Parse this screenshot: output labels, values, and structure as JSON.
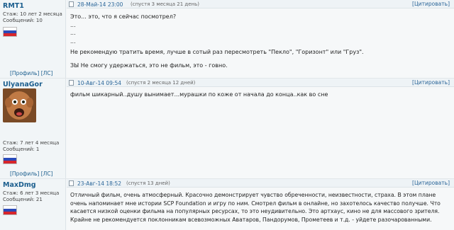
{
  "posts": [
    {
      "user": "RMT1",
      "stats": [
        "Стаж: 10 лет 2 месяца",
        "Сообщений: 10"
      ],
      "links": "[Профиль] [ЛС]",
      "date": "28-Май-14 23:00",
      "ago": "(спустя 3 месяца 21 день)",
      "quote": "[Цитировать]",
      "lines": [
        "Это... это, что я сейчас посмотрел?",
        "...",
        "...",
        "...",
        "Не рекомендую тратить время, лучше в сотый раз пересмотреть \"Пекло\", \"Горизонт\" или \"Груз\".",
        "ЗЫ Не смогу удержаться, это не фильм, это - говно."
      ]
    },
    {
      "user": "UlyanaGor",
      "stats": [
        "Стаж: 7 лет 4 месяца",
        "Сообщений: 1"
      ],
      "links": "[Профиль] [ЛС]",
      "date": "10-Авг-14 09:54",
      "ago": "(спустя 2 месяца 12 дней)",
      "quote": "[Цитировать]",
      "lines": [
        "фильм шикарный..душу вынимает...мурашки по коже от начала до конца..как во сне"
      ]
    },
    {
      "user": "MaxDmg",
      "stats": [
        "Стаж: 6 лет 3 месяца",
        "Сообщений: 21"
      ],
      "links": "[Профиль] [ЛС]",
      "date": "23-Авг-14 18:52",
      "ago": "(спустя 13 дней)",
      "quote": "[Цитировать]",
      "lines": [
        "Отличный фильм, очень атмосферный. Красочно демонстрирует чувство обреченности, неизвестности, страха. В этом плане",
        "очень напоминает мне истории SCP Foundation и игру по ним. Смотрел фильм в онлайне, но захотелось качество получше. Что",
        "касается низкой оценки фильма на популярных ресурсах, то это неудивительно. Это артхаус, кино не для массового зрителя.",
        "Крайне не рекомендуется поклонникам всевозможных Аватаров, Пандорумов, Прометеев и т.д. - уйдете разочарованными."
      ]
    }
  ]
}
